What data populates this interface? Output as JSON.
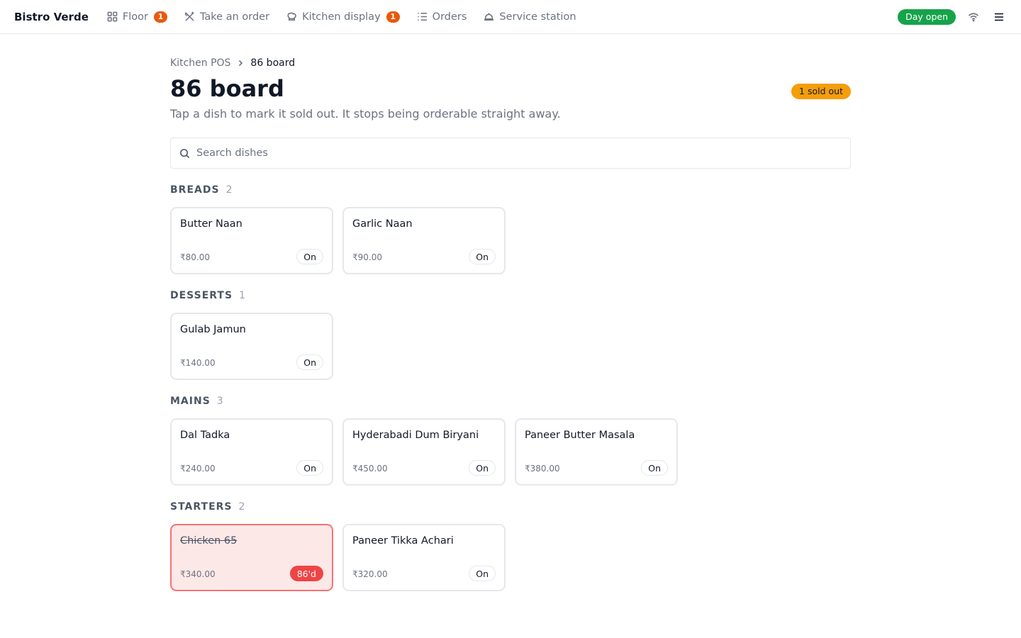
{
  "app": {
    "brand": "Bistro Verde",
    "nav": [
      {
        "label": "Floor",
        "badge": "1",
        "icon": "floor-grid-icon"
      },
      {
        "label": "Take an order",
        "badge": "",
        "icon": "utensils-icon"
      },
      {
        "label": "Kitchen display",
        "badge": "1",
        "icon": "chef-hat-icon"
      },
      {
        "label": "Orders",
        "badge": "",
        "icon": "list-icon"
      },
      {
        "label": "Service station",
        "badge": "",
        "icon": "cloche-icon"
      }
    ],
    "day_status": "Day open",
    "icons": {
      "connection": "wifi-icon",
      "menu": "hamburger-menu-icon"
    },
    "colors": {
      "accent_badge": "#ea580c",
      "day_open": "#16a34a",
      "sold_out": "#f59e0b",
      "off_card": "#fde8e8",
      "off_badge": "#ef4444"
    }
  },
  "breadcrumb": {
    "parent": "Kitchen POS",
    "current": "86 board"
  },
  "page": {
    "title": "86 board",
    "subtitle": "Tap a dish to mark it sold out. It stops being orderable straight away.",
    "sold_out_badge": "1 sold out"
  },
  "search": {
    "placeholder": "Search dishes",
    "value": ""
  },
  "sections": [
    {
      "name": "BREADS",
      "count": "2",
      "items": [
        {
          "name": "Butter Naan",
          "price": "₹80.00",
          "status": "On",
          "sold_out": false
        },
        {
          "name": "Garlic Naan",
          "price": "₹90.00",
          "status": "On",
          "sold_out": false
        }
      ]
    },
    {
      "name": "DESSERTS",
      "count": "1",
      "items": [
        {
          "name": "Gulab Jamun",
          "price": "₹140.00",
          "status": "On",
          "sold_out": false
        }
      ]
    },
    {
      "name": "MAINS",
      "count": "3",
      "items": [
        {
          "name": "Dal Tadka",
          "price": "₹240.00",
          "status": "On",
          "sold_out": false
        },
        {
          "name": "Hyderabadi Dum Biryani",
          "price": "₹450.00",
          "status": "On",
          "sold_out": false
        },
        {
          "name": "Paneer Butter Masala",
          "price": "₹380.00",
          "status": "On",
          "sold_out": false
        }
      ]
    },
    {
      "name": "STARTERS",
      "count": "2",
      "items": [
        {
          "name": "Chicken 65",
          "price": "₹340.00",
          "status": "86'd",
          "sold_out": true
        },
        {
          "name": "Paneer Tikka Achari",
          "price": "₹320.00",
          "status": "On",
          "sold_out": false
        }
      ]
    }
  ]
}
